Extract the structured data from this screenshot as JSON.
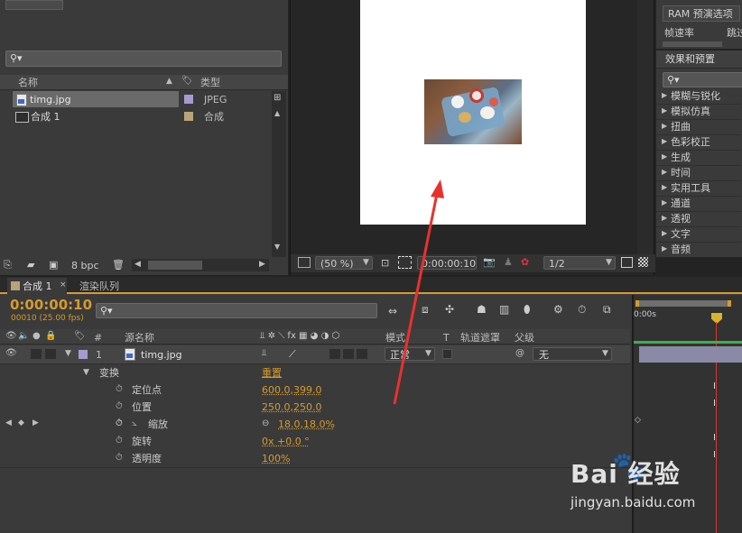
{
  "project": {
    "search_placeholder": "",
    "col_name": "名称",
    "col_type": "类型",
    "items": [
      {
        "name": "timg.jpg",
        "type": "JPEG",
        "color": "#a59bd0",
        "icon": "image-file-icon"
      },
      {
        "name": "合成 1",
        "type": "合成",
        "color": "#b8a47a",
        "icon": "composition-icon"
      }
    ],
    "bpc": "8 bpc"
  },
  "viewer": {
    "zoom": "(50 %)",
    "timecode": "0:00:00:10",
    "resolution": "1/2"
  },
  "preview_panel": {
    "title": "RAM 预演选项",
    "frame_rate": "帧速率",
    "skip": "跳过"
  },
  "effects": {
    "title": "效果和预置",
    "items": [
      "模糊与锐化",
      "模拟仿真",
      "扭曲",
      "色彩校正",
      "生成",
      "时间",
      "实用工具",
      "通道",
      "透视",
      "文字",
      "音频"
    ]
  },
  "timeline": {
    "tab_comp": "合成 1",
    "tab_render": "渲染队列",
    "timecode": "0:00:00:10",
    "frame_info": "00010 (25.00 fps)",
    "ruler_start": "0:00s",
    "col_num": "#",
    "col_source": "源名称",
    "col_mode": "模式",
    "col_t": "T",
    "col_trkmat": "轨道遮罩",
    "col_parent": "父级",
    "layer": {
      "index": "1",
      "name": "timg.jpg",
      "mode": "正常",
      "parent": "无",
      "color": "#a59bd0"
    },
    "transform": {
      "label": "变换",
      "reset": "重置"
    },
    "properties": [
      {
        "label": "定位点",
        "value": "600.0,399.0"
      },
      {
        "label": "位置",
        "value": "250.0,250.0"
      },
      {
        "label": "缩放",
        "value": "18.0,18.0%"
      },
      {
        "label": "旋转",
        "value": "0x +0.0 °"
      },
      {
        "label": "透明度",
        "value": "100%"
      }
    ]
  },
  "watermark": {
    "brand": "Bai 经验",
    "url": "jingyan.baidu.com"
  },
  "colors": {
    "accent": "#d79a2c",
    "annotation_arrow": "#e8312f",
    "timeline_bar": "#8a8aa6",
    "green_bar": "#3fb04a"
  }
}
